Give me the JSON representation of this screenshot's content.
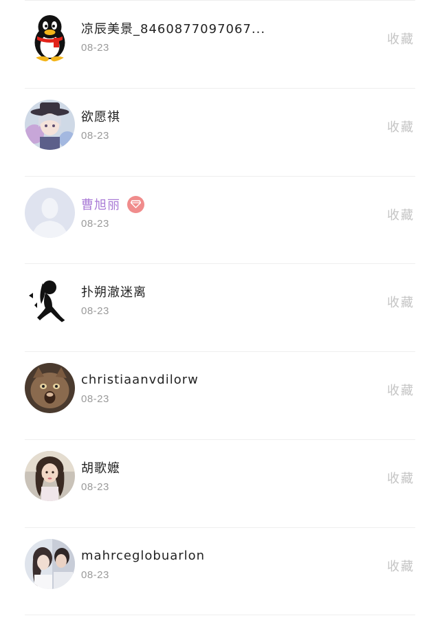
{
  "items": [
    {
      "name": "凉辰美景_8460877097067...",
      "date": "08-23",
      "action": "收藏",
      "avatar": "qq-penguin-avatar",
      "vip": false
    },
    {
      "name": "欲愿祺",
      "date": "08-23",
      "action": "收藏",
      "avatar": "anime-hat-avatar",
      "vip": false
    },
    {
      "name": "曹旭丽",
      "date": "08-23",
      "action": "收藏",
      "avatar": "default-person-avatar",
      "vip": true
    },
    {
      "name": "扑朔澈迷离",
      "date": "08-23",
      "action": "收藏",
      "avatar": "silhouette-girl-avatar",
      "vip": false
    },
    {
      "name": "christiaanvdilorw",
      "date": "08-23",
      "action": "收藏",
      "avatar": "cat-avatar",
      "vip": false
    },
    {
      "name": "胡歌嬷",
      "date": "08-23",
      "action": "收藏",
      "avatar": "girl-photo-avatar",
      "vip": false
    },
    {
      "name": "mahrceglobuarlon",
      "date": "08-23",
      "action": "收藏",
      "avatar": "couple-photo-avatar",
      "vip": false
    }
  ],
  "colors": {
    "name": "#222222",
    "vip_name": "#a97ad6",
    "vip_badge": "#f08c8c",
    "date": "#9a9a9a",
    "action": "#c4c4c4",
    "divider": "#eeeeee"
  },
  "vip_badge_icon": "diamond-icon"
}
